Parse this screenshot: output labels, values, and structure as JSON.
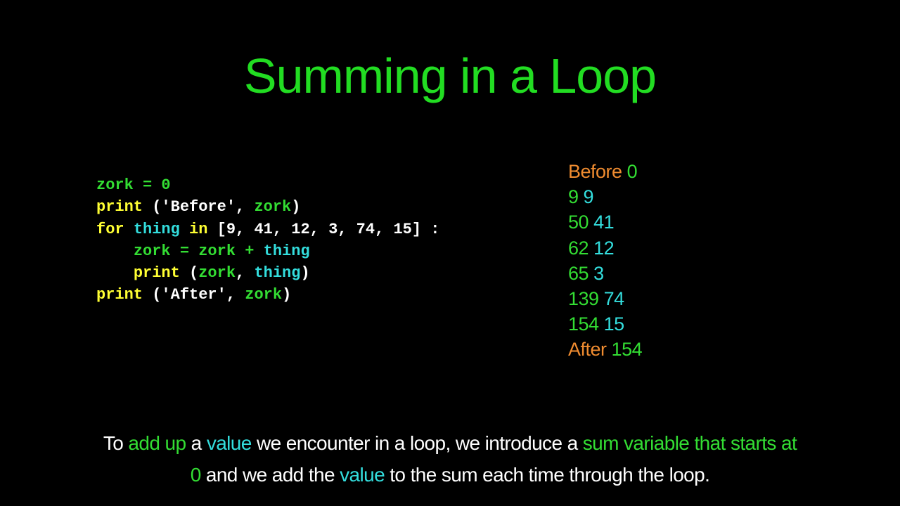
{
  "title": "Summing in a Loop",
  "code": {
    "line1": {
      "var": "zork",
      "op": " = ",
      "num": "0"
    },
    "line2": {
      "kw": "print",
      "open": " ('Before', ",
      "var": "zork",
      "close": ")"
    },
    "line3": {
      "kw": "for",
      "sp": " ",
      "var": "thing",
      "sp2": " ",
      "kw2": "in",
      "list": " [9, 41, 12, 3, 74, 15] :"
    },
    "line4": {
      "indent": "    ",
      "var": "zork",
      "op": " = ",
      "var2": "zork",
      "op2": " + ",
      "var3": "thing"
    },
    "line5": {
      "indent": "    ",
      "kw": "print",
      "open": " (",
      "var": "zork",
      "sep": ", ",
      "var2": "thing",
      "close": ")"
    },
    "line6": {
      "kw": "print",
      "open": " ('After', ",
      "var": "zork",
      "close": ")"
    }
  },
  "output": [
    {
      "a": "Before",
      "b": "0"
    },
    {
      "a": "9",
      "b": "9"
    },
    {
      "a": "50",
      "b": "41"
    },
    {
      "a": "62",
      "b": "12"
    },
    {
      "a": "65",
      "b": "3"
    },
    {
      "a": "139",
      "b": "74"
    },
    {
      "a": "154",
      "b": "15"
    },
    {
      "a": "After",
      "b": "154"
    }
  ],
  "caption": {
    "p1": "To ",
    "h1": "add up",
    "p2": " a ",
    "h2": "value",
    "p3": " we encounter in a loop,  we introduce a ",
    "h3": "sum variable that starts at",
    "h4": "0",
    "p4": " and we add the ",
    "h5": "value",
    "p5": " to the sum each time through the loop."
  }
}
